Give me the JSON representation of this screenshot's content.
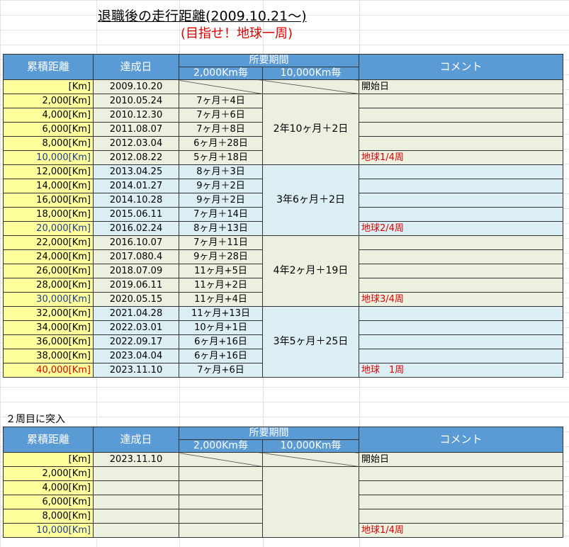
{
  "title": "退職後の走行距離(2009.10.21～)",
  "subtitle": "(目指せ！地球一周)",
  "second_label": "２周目に突入",
  "headers": {
    "distance": "累積距離",
    "date": "達成日",
    "period": "所要期間",
    "per2000": "2,000Km毎",
    "per10000": "10,000Km毎",
    "comment": "コメント"
  },
  "table1": [
    {
      "dist": "[Km]",
      "date": "2009.10.20",
      "dur": "",
      "comment": "開始日"
    },
    {
      "dist": "2,000[Km]",
      "date": "2010.05.24",
      "dur": "7ヶ月＋4日",
      "comment": ""
    },
    {
      "dist": "4,000[Km]",
      "date": "2010.12.30",
      "dur": "7ヶ月＋6日",
      "comment": ""
    },
    {
      "dist": "6,000[Km]",
      "date": "2011.08.07",
      "dur": "7ヶ月＋8日",
      "comment": ""
    },
    {
      "dist": "8,000[Km]",
      "date": "2012.03.04",
      "dur": "6ヶ月＋28日",
      "comment": ""
    },
    {
      "dist": "10,000[Km]",
      "date": "2012.08.22",
      "dur": "5ヶ月＋18日",
      "comment": "地球1/4周"
    },
    {
      "dist": "12,000[Km]",
      "date": "2013.04.25",
      "dur": "8ヶ月＋3日",
      "comment": ""
    },
    {
      "dist": "14,000[Km]",
      "date": "2014.01.27",
      "dur": "9ヶ月＋2日",
      "comment": ""
    },
    {
      "dist": "16,000[Km]",
      "date": "2014.10.28",
      "dur": "9ヶ月＋2日",
      "comment": ""
    },
    {
      "dist": "18,000[Km]",
      "date": "2015.06.11",
      "dur": "7ヶ月＋14日",
      "comment": ""
    },
    {
      "dist": "20,000[Km]",
      "date": "2016.02.24",
      "dur": "8ヶ月＋13日",
      "comment": "地球2/4周"
    },
    {
      "dist": "22,000[Km]",
      "date": "2016.10.07",
      "dur": "7ヶ月＋11日",
      "comment": ""
    },
    {
      "dist": "24,000[Km]",
      "date": "2017.080.4",
      "dur": "9ヶ月＋28日",
      "comment": ""
    },
    {
      "dist": "26,000[Km]",
      "date": "2018.07.09",
      "dur": "11ヶ月+5日",
      "comment": ""
    },
    {
      "dist": "28,000[Km]",
      "date": "2019.06.11",
      "dur": "11ヶ月+2日",
      "comment": ""
    },
    {
      "dist": "30,000[Km]",
      "date": "2020.05.15",
      "dur": "11ヶ月+4日",
      "comment": "地球3/4周"
    },
    {
      "dist": "32,000[Km]",
      "date": "2021.04.28",
      "dur": "11ヶ月+13日",
      "comment": ""
    },
    {
      "dist": "34,000[Km]",
      "date": "2022.03.01",
      "dur": "10ヶ月+1日",
      "comment": ""
    },
    {
      "dist": "36,000[Km]",
      "date": "2022.09.17",
      "dur": "6ヶ月+16日",
      "comment": ""
    },
    {
      "dist": "38,000[Km]",
      "date": "2023.04.04",
      "dur": "6ヶ月+16日",
      "comment": ""
    },
    {
      "dist": "40,000[Km]",
      "date": "2023.11.10",
      "dur": "7ヶ月+6日",
      "comment": "地球　1周"
    }
  ],
  "table1_blocks": [
    "2年10ヶ月＋2日",
    "3年6ヶ月＋2日",
    "4年2ヶ月＋19日",
    "3年5ヶ月＋25日"
  ],
  "table2": [
    {
      "dist": "[Km]",
      "date": "2023.11.10",
      "comment": "開始日"
    },
    {
      "dist": "2,000[Km]",
      "date": "",
      "comment": ""
    },
    {
      "dist": "4,000[Km]",
      "date": "",
      "comment": ""
    },
    {
      "dist": "6,000[Km]",
      "date": "",
      "comment": ""
    },
    {
      "dist": "8,000[Km]",
      "date": "",
      "comment": ""
    },
    {
      "dist": "10,000[Km]",
      "date": "",
      "comment": "地球1/4周"
    }
  ]
}
